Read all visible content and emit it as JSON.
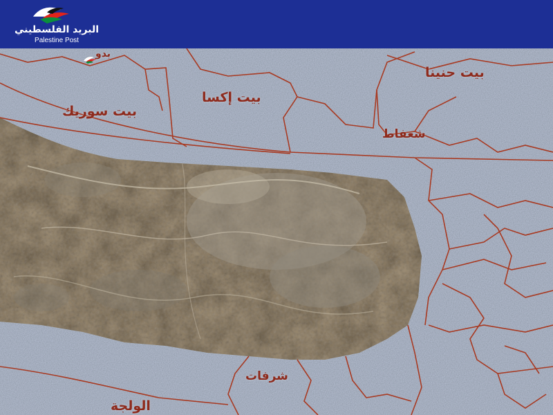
{
  "brand": {
    "name_ar": "البريد الفلسطيني",
    "name_en": "Palestine Post",
    "logo_icon": "palestine-post-bird-logo"
  },
  "map": {
    "type": "satellite map with village boundaries",
    "boundary_color": "#a83a22",
    "label_color": "#8e2a1c",
    "places": {
      "biddu": "بدو",
      "beit_hanina": "بيت حنينا",
      "beit_iksa": "بيت إكسا",
      "beit_surik": "بيت سوريك",
      "shuafat": "شعفاط",
      "sharafat": "شرفات",
      "al_walaja": "الولجة"
    }
  }
}
